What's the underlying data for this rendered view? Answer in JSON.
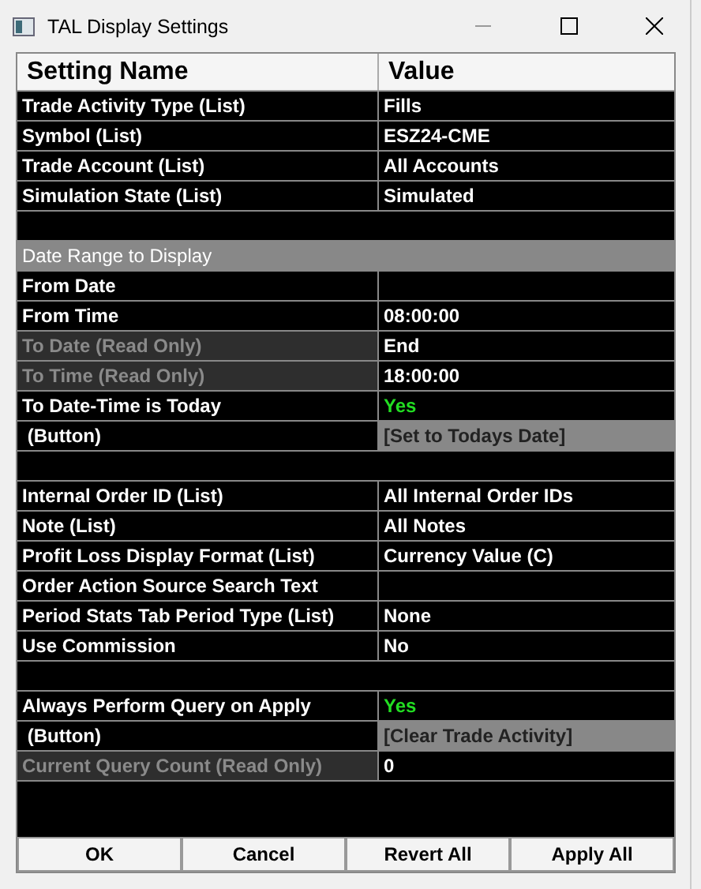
{
  "window": {
    "title": "TAL Display Settings"
  },
  "columns": [
    "Setting Name",
    "Value"
  ],
  "rows": [
    {
      "kind": "setting",
      "name": "Trade Activity Type (List)",
      "value": "Fills"
    },
    {
      "kind": "setting",
      "name": "Symbol (List)",
      "value": "ESZ24-CME"
    },
    {
      "kind": "setting",
      "name": "Trade Account (List)",
      "value": "All Accounts"
    },
    {
      "kind": "setting",
      "name": "Simulation State (List)",
      "value": "Simulated"
    },
    {
      "kind": "blank"
    },
    {
      "kind": "section",
      "name": "Date Range to Display"
    },
    {
      "kind": "setting",
      "name": "From Date"
    },
    {
      "kind": "setting",
      "name": "From Time",
      "value": "08:00:00"
    },
    {
      "kind": "readonly",
      "name": "To Date (Read Only)",
      "value": "End"
    },
    {
      "kind": "readonly",
      "name": "To Time (Read Only)",
      "value": "18:00:00"
    },
    {
      "kind": "setting",
      "name": "To Date-Time is Today",
      "value": "Yes",
      "color": "#22dd22"
    },
    {
      "kind": "button",
      "name": " (Button)",
      "value": "[Set to Todays Date]"
    },
    {
      "kind": "blank"
    },
    {
      "kind": "setting",
      "name": "Internal Order ID (List)",
      "value": "All Internal Order IDs"
    },
    {
      "kind": "setting",
      "name": "Note (List)",
      "value": "All Notes"
    },
    {
      "kind": "setting",
      "name": "Profit Loss Display Format (List)",
      "value": "Currency Value (C)"
    },
    {
      "kind": "setting",
      "name": "Order Action Source Search Text"
    },
    {
      "kind": "setting",
      "name": "Period Stats Tab Period Type (List)",
      "value": "None"
    },
    {
      "kind": "setting",
      "name": "Use Commission",
      "value": "No"
    },
    {
      "kind": "blank"
    },
    {
      "kind": "setting",
      "name": "Always Perform Query on Apply",
      "value": "Yes",
      "color": "#22dd22"
    },
    {
      "kind": "button",
      "name": " (Button)",
      "value": "[Clear Trade Activity]"
    },
    {
      "kind": "readonly",
      "name": "Current Query Count (Read Only)",
      "value": "0"
    }
  ],
  "buttons": [
    "OK",
    "Cancel",
    "Revert All",
    "Apply All"
  ]
}
